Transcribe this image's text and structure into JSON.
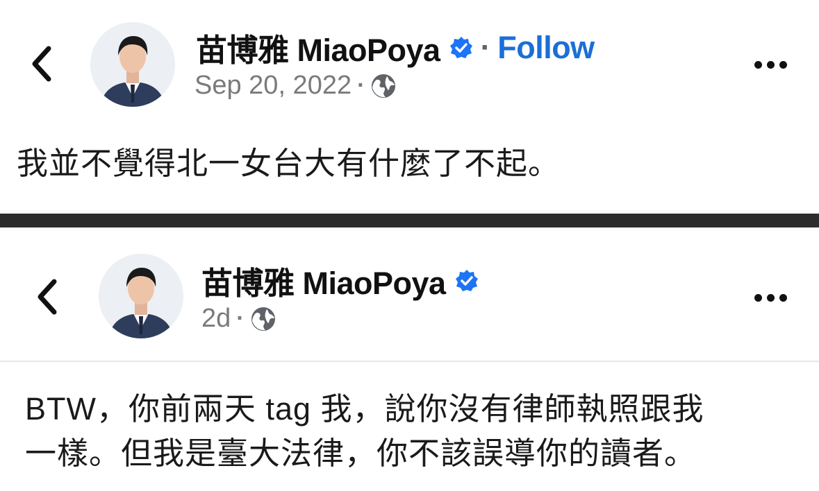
{
  "posts": [
    {
      "author": "苗博雅 MiaoPoya",
      "follow_label": "Follow",
      "separator": "·",
      "timestamp": "Sep 20, 2022",
      "privacy_icon": "globe-icon",
      "verified_icon": "verified-badge-icon",
      "body_lines": [
        "我並不覺得北一女台大有什麼了不起。"
      ]
    },
    {
      "author": "苗博雅 MiaoPoya",
      "separator": "·",
      "timestamp": "2d",
      "privacy_icon": "globe-icon",
      "verified_icon": "verified-badge-icon",
      "body_lines": [
        "BTW，你前兩天 tag 我，說你沒有律師執照跟我",
        "一樣。但我是臺大法律，你不該誤導你的讀者。"
      ]
    }
  ],
  "colors": {
    "follow": "#1b6fd6",
    "verified": "#1d74f5",
    "divider": "#2c2c2c",
    "meta": "#7a7a7a"
  }
}
